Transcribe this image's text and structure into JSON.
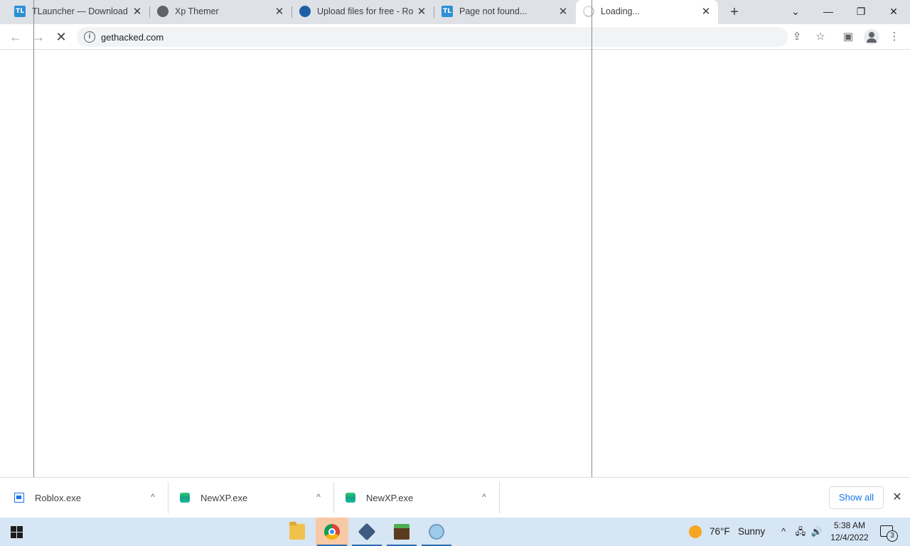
{
  "tabs": [
    {
      "title": "TLauncher — Download Minecraft",
      "favicon": "tlauncher-icon"
    },
    {
      "title": "Xp Themer",
      "favicon": "globe-icon"
    },
    {
      "title": "Upload files for free - Roblox",
      "favicon": "cloud-icon"
    },
    {
      "title": "Page not found...",
      "favicon": "tlauncher-icon"
    },
    {
      "title": "Loading...",
      "favicon": "loading-spinner-icon",
      "active": true
    }
  ],
  "tab_strip": {
    "new_tab": "+",
    "tab_search": "⌄",
    "minimize": "—",
    "restore": "❐",
    "close": "✕",
    "tab_close": "✕",
    "tl_badge": "TL"
  },
  "toolbar": {
    "back": "←",
    "forward": "→",
    "stop": "✕",
    "info": "i",
    "url": "gethacked.com",
    "share": "⇪",
    "bookmark": "☆",
    "side_panel": "▣"
  },
  "downloads": {
    "items": [
      {
        "name": "Roblox.exe",
        "icon": "roblox-installer-icon"
      },
      {
        "name": "NewXP.exe",
        "icon": "newxp-icon"
      },
      {
        "name": "NewXP.exe",
        "icon": "newxp-icon"
      }
    ],
    "caret": "^",
    "show_all": "Show all",
    "close": "✕"
  },
  "taskbar": {
    "apps": [
      {
        "name": "file-explorer",
        "active": false
      },
      {
        "name": "chrome",
        "active": true
      },
      {
        "name": "virtualbox",
        "active": false
      },
      {
        "name": "minecraft",
        "active": false
      },
      {
        "name": "tool",
        "active": false
      }
    ],
    "weather": {
      "temp": "76°F",
      "condition": "Sunny"
    },
    "tray": {
      "chevron": "^",
      "network": "🖧",
      "volume": "🔊"
    },
    "time": "5:38 AM",
    "date": "12/4/2022",
    "notifications": "3"
  },
  "colors": {
    "tabstrip_bg": "#dee1e6",
    "taskbar_bg": "#d7e6f4",
    "link_blue": "#1a73e8"
  }
}
